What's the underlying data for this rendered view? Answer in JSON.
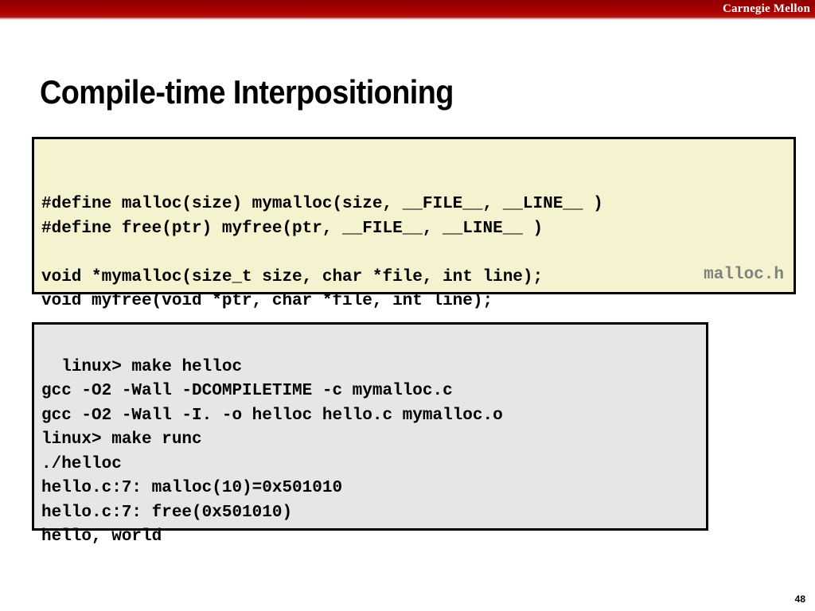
{
  "header": {
    "brand": "Carnegie Mellon",
    "banner_color": "#9c0000",
    "brand_color": "#ffffff"
  },
  "slide": {
    "title": "Compile-time Interpositioning",
    "page_number": "48"
  },
  "header_code_box": {
    "background_color": "#f5f3cf",
    "border_color": "#000000",
    "file_label": "malloc.h",
    "file_label_color": "#808080",
    "code": "#define malloc(size) mymalloc(size, __FILE__, __LINE__ )\n#define free(ptr) myfree(ptr, __FILE__, __LINE__ )\n\nvoid *mymalloc(size_t size, char *file, int line);\nvoid myfree(void *ptr, char *file, int line);",
    "lines": [
      "#define malloc(size) mymalloc(size, __FILE__, __LINE__ )",
      "#define free(ptr) myfree(ptr, __FILE__, __LINE__ )",
      "",
      "void *mymalloc(size_t size, char *file, int line);",
      "void myfree(void *ptr, char *file, int line);"
    ]
  },
  "terminal_box": {
    "background_color": "#e6e6e6",
    "border_color": "#000000",
    "code": "linux> make helloc\ngcc -O2 -Wall -DCOMPILETIME -c mymalloc.c\ngcc -O2 -Wall -I. -o helloc hello.c mymalloc.o\nlinux> make runc\n./helloc\nhello.c:7: malloc(10)=0x501010\nhello.c:7: free(0x501010)\nhello, world",
    "lines": [
      "linux> make helloc",
      "gcc -O2 -Wall -DCOMPILETIME -c mymalloc.c",
      "gcc -O2 -Wall -I. -o helloc hello.c mymalloc.o",
      "linux> make runc",
      "./helloc",
      "hello.c:7: malloc(10)=0x501010",
      "hello.c:7: free(0x501010)",
      "hello, world"
    ]
  }
}
